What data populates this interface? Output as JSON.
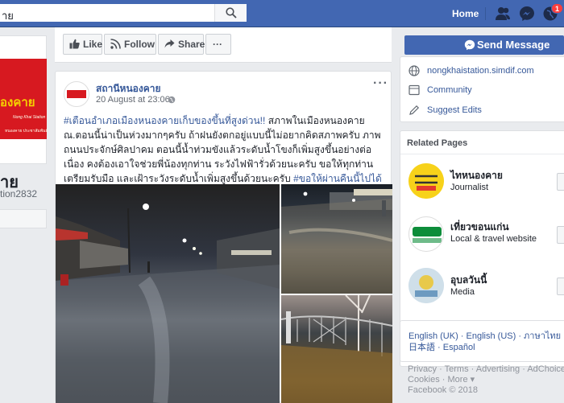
{
  "header": {
    "search_value": "าย",
    "home_label": "Home",
    "notification_count": "1"
  },
  "left": {
    "page_name_partial": "าย",
    "page_handle_partial": "tion2832",
    "logo_text": "องคาย",
    "logo_sub": "Nong Khai Station",
    "logo_sub2": "หนองคาย ประชาสัมพันธ์"
  },
  "actions": {
    "like": "Like",
    "follow": "Follow",
    "share": "Share",
    "more": "···",
    "send_message": "Send Message"
  },
  "post": {
    "author": "สถานีหนองคาย",
    "time": "20 August at 23:06 · ",
    "more": "···",
    "hashtag1": "#เตือนอำเภอเมืองหนองคายเก็บของขึ้นที่สูงด่วน!!",
    "body": " สภาพในเมืองหนองคาย ณ.ตอนนี้น่าเป็นห่วงมากๆครับ ถ้าฝนยังตกอยู่แบบนี้ไม่อยากคิดสภาพครับ ภาพถนนประจักษ์ศิลปาคม ตอนนี้น้ำท่วมขังแล้วระดับน้ำโขงก็เพิ่มสูงขึ้นอย่างต่อเนื่อง คงต้องเอาใจช่วยพี่น้องทุกท่าน ระวังไฟฟ้ารั่วด้วยนะครับ ขอให้ทุกท่านเตรียมรับมือ และเฝ้าระวังระดับน้ำเพิ่มสูงขึ้นด้วยนะครับ ",
    "hashtag2": "#ขอให้ผ่านคืนนี้ไปได้ด้วยดีครับ"
  },
  "sidebar": {
    "website": "nongkhaistation.simdif.com",
    "community": "Community",
    "suggest_edits": "Suggest Edits",
    "related_title": "Related Pages",
    "related": [
      {
        "name": "ไทหนองคาย",
        "category": "Journalist"
      },
      {
        "name": "เที่ยวขอนแก่น",
        "category": "Local & travel website"
      },
      {
        "name": "อุบลวันนี้",
        "category": "Media"
      }
    ],
    "languages_line1": "English (UK) · English (US) · ภาษาไทย ·",
    "languages_line2": "日本語 · Español",
    "footer_line1": "Privacy · Terms · Advertising · AdChoices ▷ ·",
    "footer_line2": "Cookies · More ▾",
    "footer_line3": "Facebook © 2018"
  },
  "colors": {
    "brand": "#4267b2",
    "link": "#365899",
    "logo_red": "#d71920",
    "logo_yellow": "#f5d000"
  }
}
